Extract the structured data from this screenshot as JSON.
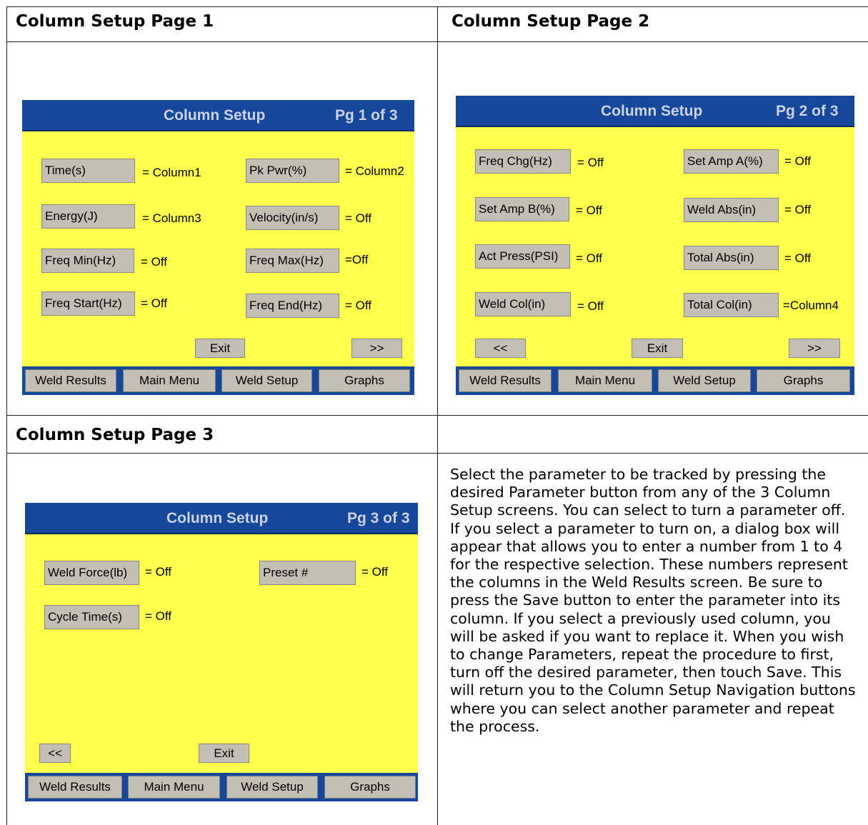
{
  "headers": {
    "page1": "Column Setup Page 1",
    "page2": "Column Setup Page 2",
    "page3": "Column Setup Page 3"
  },
  "screen1": {
    "title": "Column Setup",
    "page": "Pg 1 of 3",
    "params": [
      {
        "label": "Time(s)",
        "value": "= Column1"
      },
      {
        "label": "Pk Pwr(%)",
        "value": "= Column2"
      },
      {
        "label": "Energy(J)",
        "value": "= Column3"
      },
      {
        "label": "Velocity(in/s)",
        "value": "= Off"
      },
      {
        "label": "Freq Min(Hz)",
        "value": "= Off"
      },
      {
        "label": "Freq Max(Hz)",
        "value": "=Off"
      },
      {
        "label": "Freq Start(Hz)",
        "value": "= Off"
      },
      {
        "label": "Freq End(Hz)",
        "value": "= Off"
      }
    ],
    "exit": "Exit",
    "next": ">>"
  },
  "screen2": {
    "title": "Column Setup",
    "page": "Pg 2 of 3",
    "params": [
      {
        "label": "Freq Chg(Hz)",
        "value": "= Off"
      },
      {
        "label": "Set Amp A(%)",
        "value": "= Off"
      },
      {
        "label": "Set Amp B(%)",
        "value": "= Off"
      },
      {
        "label": "Weld Abs(in)",
        "value": "= Off"
      },
      {
        "label": "Act Press(PSI)",
        "value": "= Off"
      },
      {
        "label": "Total Abs(in)",
        "value": "= Off"
      },
      {
        "label": "Weld Col(in)",
        "value": "= Off"
      },
      {
        "label": "Total Col(in)",
        "value": "=Column4"
      }
    ],
    "prev": "<<",
    "exit": "Exit",
    "next": ">>"
  },
  "screen3": {
    "title": "Column Setup",
    "page": "Pg 3 of 3",
    "params": [
      {
        "label": "Weld Force(lb)",
        "value": "= Off"
      },
      {
        "label": "Preset #",
        "value": "= Off"
      },
      {
        "label": "Cycle Time(s)",
        "value": "= Off"
      }
    ],
    "prev": "<<",
    "exit": "Exit"
  },
  "nav": [
    "Weld Results",
    "Main Menu",
    "Weld Setup",
    "Graphs"
  ],
  "description": "Select the parameter to be tracked by pressing the desired Parameter button from any of the 3 Column Setup screens. You can select to turn a parameter off. If you select a parameter to turn on, a dialog box will appear that allows you to enter a number from 1 to 4 for the respective selection. These numbers represent the columns in the Weld Results screen. Be sure to press the Save button to enter the parameter into its column. If you select a previously used column, you will be asked if you want to replace it. When you wish to change Parameters, repeat the procedure to first, turn off the desired parameter, then touch Save. This will return you to the Column Setup Navigation buttons where you can select another parameter and repeat the process.",
  "colors": {
    "screen_bg": "#ffff4d",
    "titlebar": "#17479a",
    "button": "#c2bfb4"
  }
}
